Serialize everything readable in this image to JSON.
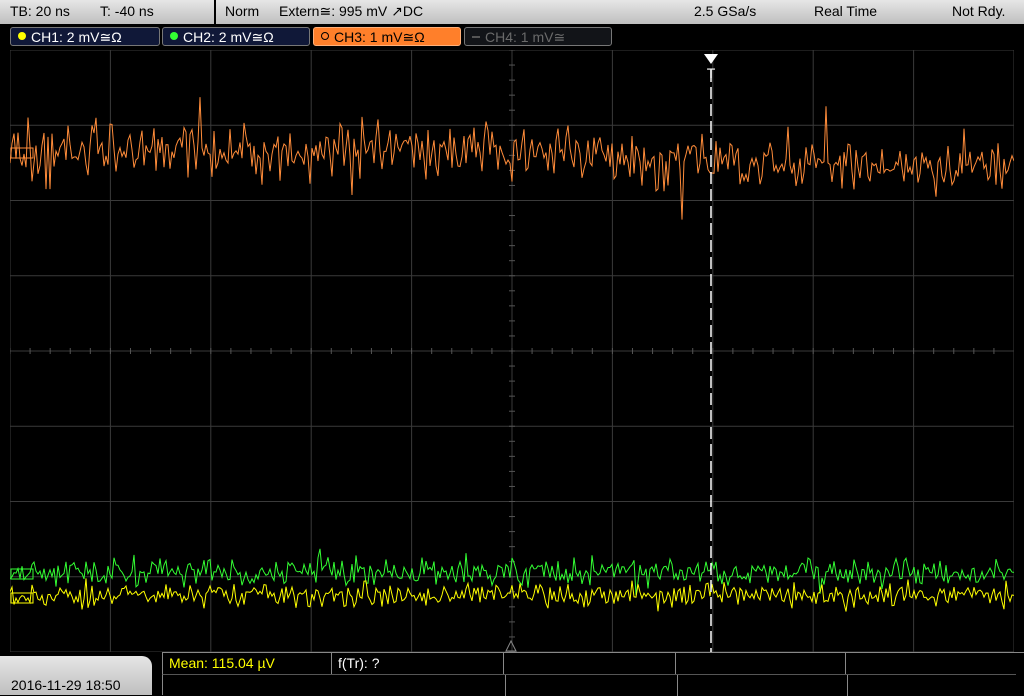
{
  "topbar": {
    "timebase": "TB: 20 ns",
    "trigger_pos": "T: -40 ns",
    "mode": "Norm",
    "trigger_source": "Extern≅: 995 mV ↗DC",
    "sample_rate": "2.5 GSa/s",
    "acq_mode": "Real Time",
    "status": "Not Rdy."
  },
  "channels": [
    {
      "label": "CH1: 2 mV≅Ω",
      "color": "#ffff00",
      "active": true
    },
    {
      "label": "CH2: 2 mV≅Ω",
      "color": "#33ff33",
      "active": true
    },
    {
      "label": "CH3: 1 mV≅Ω",
      "color": "#ff8c3a",
      "active": true,
      "selected": true
    },
    {
      "label": "CH4: 1 mV≅",
      "color": "#666666",
      "active": false
    }
  ],
  "trigger_marker": "T",
  "bottom": {
    "datetime": "2016-11-29 18:50",
    "mean": "Mean: 115.04 µV",
    "freq": "f(Tr): ?"
  },
  "colors": {
    "grid": "#3a3a3a",
    "ch1": "#ffff00",
    "ch2": "#33ff33",
    "ch3": "#ff8c3a",
    "ch3_selected_bg": "#ff7f2a"
  }
}
